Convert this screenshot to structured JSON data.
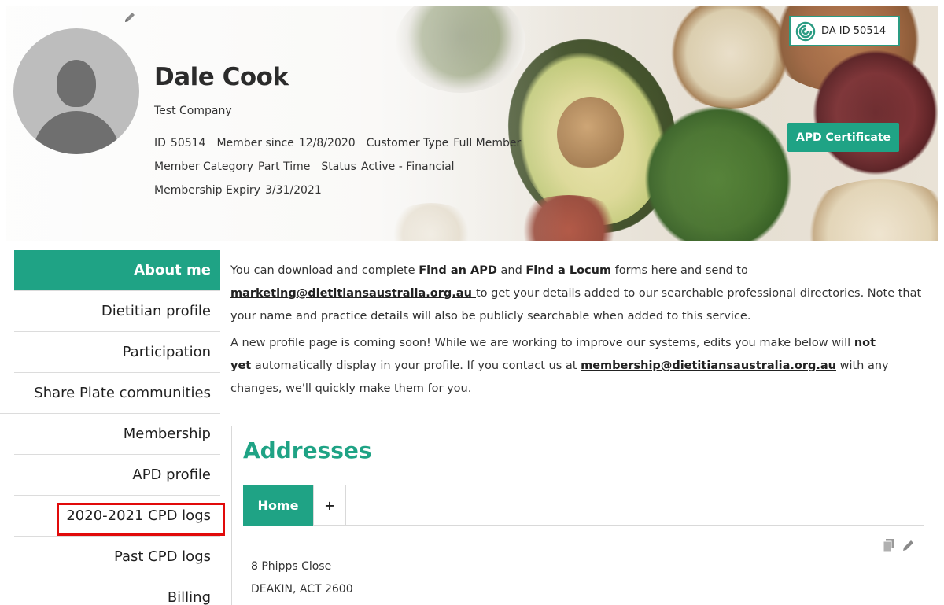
{
  "profile": {
    "name": "Dale Cook",
    "company": "Test Company",
    "id_label": "ID",
    "id_value": "50514",
    "member_since_label": "Member since",
    "member_since_value": "12/8/2020",
    "customer_type_label": "Customer Type",
    "customer_type_value": "Full Member",
    "member_category_label": "Member Category",
    "member_category_value": "Part Time",
    "status_label": "Status",
    "status_value": "Active - Financial",
    "expiry_label": "Membership Expiry",
    "expiry_value": "3/31/2021",
    "da_id": "DA ID 50514",
    "apd_certificate_label": "APD Certificate"
  },
  "sidebar": {
    "items": [
      {
        "label": "About me",
        "active": true
      },
      {
        "label": "Dietitian profile"
      },
      {
        "label": "Participation"
      },
      {
        "label": "Share Plate communities"
      },
      {
        "label": "Membership"
      },
      {
        "label": "APD profile"
      },
      {
        "label": "2020-2021 CPD logs",
        "highlighted": true
      },
      {
        "label": "Past CPD logs"
      },
      {
        "label": "Billing"
      }
    ]
  },
  "intro": {
    "p1_a": "You can download and complete ",
    "find_apd": "Find an APD",
    "p1_b": " and ",
    "find_locum": "Find a Locum",
    "p1_c": " forms here and send to",
    "marketing_email": "marketing@dietitiansaustralia.org.au ",
    "p1_d": "to get your details added to our searchable professional directories. Note that your name and practice details will also be publicly searchable when added to this service.",
    "p2_a": "A new profile page is coming soon! While we are working to improve our systems, edits you make below will ",
    "p2_bold1": "not",
    "p2_bold2": "yet",
    "p2_b": " automatically display in your profile. If you contact us at ",
    "membership_email": "membership@dietitiansaustralia.org.au",
    "p2_c": " with any changes, we'll quickly make them for you."
  },
  "addresses": {
    "title": "Addresses",
    "tab_home": "Home",
    "tab_add": "+",
    "line1": "8 Phipps Close",
    "line2": "DEAKIN, ACT 2600"
  },
  "colors": {
    "accent": "#1fa385",
    "highlight_border": "#e10a0a"
  }
}
